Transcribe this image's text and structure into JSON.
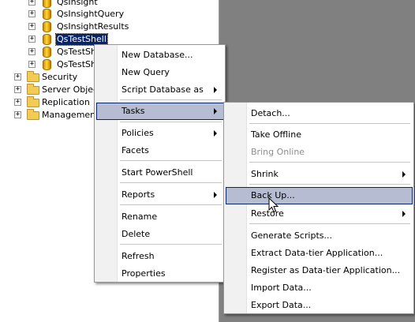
{
  "tree": {
    "databases": [
      {
        "label": "QsInsight"
      },
      {
        "label": "QsInsightQuery"
      },
      {
        "label": "QsInsightResults"
      },
      {
        "label": "QsTestShell"
      },
      {
        "label": "QsTestSh"
      },
      {
        "label": "QsTestSh"
      }
    ],
    "folders": [
      {
        "label": "Security"
      },
      {
        "label": "Server Objects"
      },
      {
        "label": "Replication"
      },
      {
        "label": "Management"
      }
    ],
    "expander_glyph": "+"
  },
  "context_menu": {
    "items": [
      {
        "label": "New Database..."
      },
      {
        "label": "New Query"
      },
      {
        "label": "Script Database as"
      },
      {
        "label": "Tasks"
      },
      {
        "label": "Policies"
      },
      {
        "label": "Facets"
      },
      {
        "label": "Start PowerShell"
      },
      {
        "label": "Reports"
      },
      {
        "label": "Rename"
      },
      {
        "label": "Delete"
      },
      {
        "label": "Refresh"
      },
      {
        "label": "Properties"
      }
    ]
  },
  "tasks_menu": {
    "items": [
      {
        "label": "Detach..."
      },
      {
        "label": "Take Offline"
      },
      {
        "label": "Bring Online"
      },
      {
        "label": "Shrink"
      },
      {
        "label": "Back Up..."
      },
      {
        "label": "Restore"
      },
      {
        "label": "Generate Scripts..."
      },
      {
        "label": "Extract Data-tier Application..."
      },
      {
        "label": "Register as Data-tier Application..."
      },
      {
        "label": "Import Data..."
      },
      {
        "label": "Export Data..."
      }
    ]
  },
  "colors": {
    "background": "#808080",
    "selection": "#0a246a",
    "menu_highlight": "#b6bdd2",
    "disabled_text": "#8d8d8d"
  }
}
